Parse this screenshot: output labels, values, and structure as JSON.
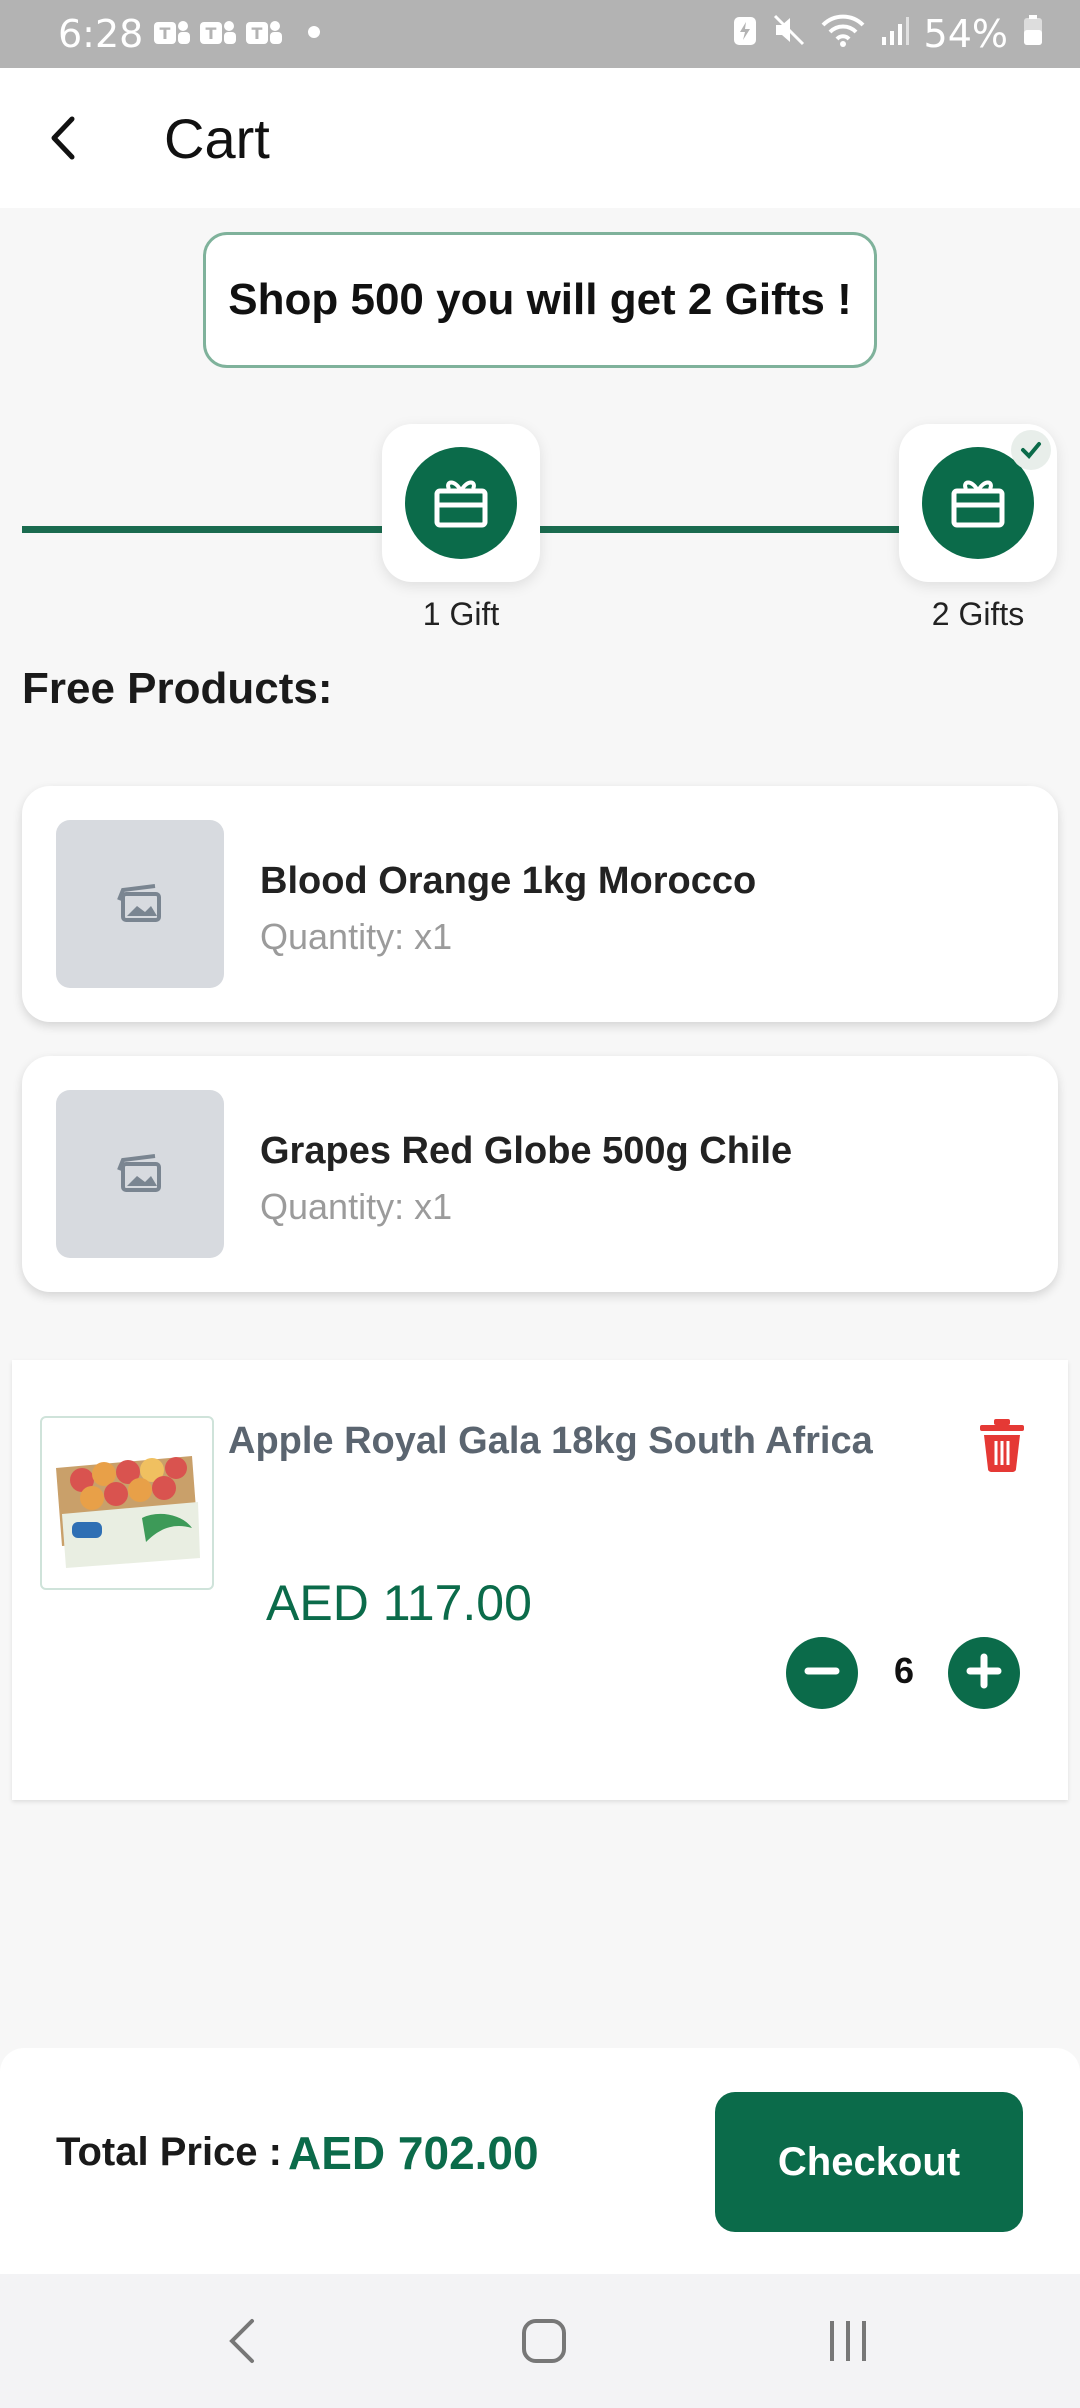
{
  "status_bar": {
    "time": "6:28",
    "battery": "54%"
  },
  "header": {
    "title": "Cart"
  },
  "banner": {
    "text": "Shop 500 you will get 2 Gifts !"
  },
  "gift_progress": {
    "milestones": [
      {
        "label": "1 Gift",
        "achieved": false
      },
      {
        "label": "2 Gifts",
        "achieved": true
      }
    ]
  },
  "free_products": {
    "title": "Free Products:",
    "items": [
      {
        "name": "Blood Orange 1kg Morocco",
        "quantity": "Quantity: x1"
      },
      {
        "name": "Grapes Red Globe 500g Chile",
        "quantity": "Quantity: x1"
      }
    ]
  },
  "cart_items": [
    {
      "name": "Apple Royal Gala 18kg South Africa",
      "price": "AED 117.00",
      "quantity": "6"
    }
  ],
  "footer": {
    "total_label": "Total Price :",
    "total_value": "AED 702.00",
    "checkout_label": "Checkout"
  },
  "colors": {
    "primary": "#0b6b4a",
    "delete": "#e53935",
    "muted": "#9b9b9b"
  }
}
